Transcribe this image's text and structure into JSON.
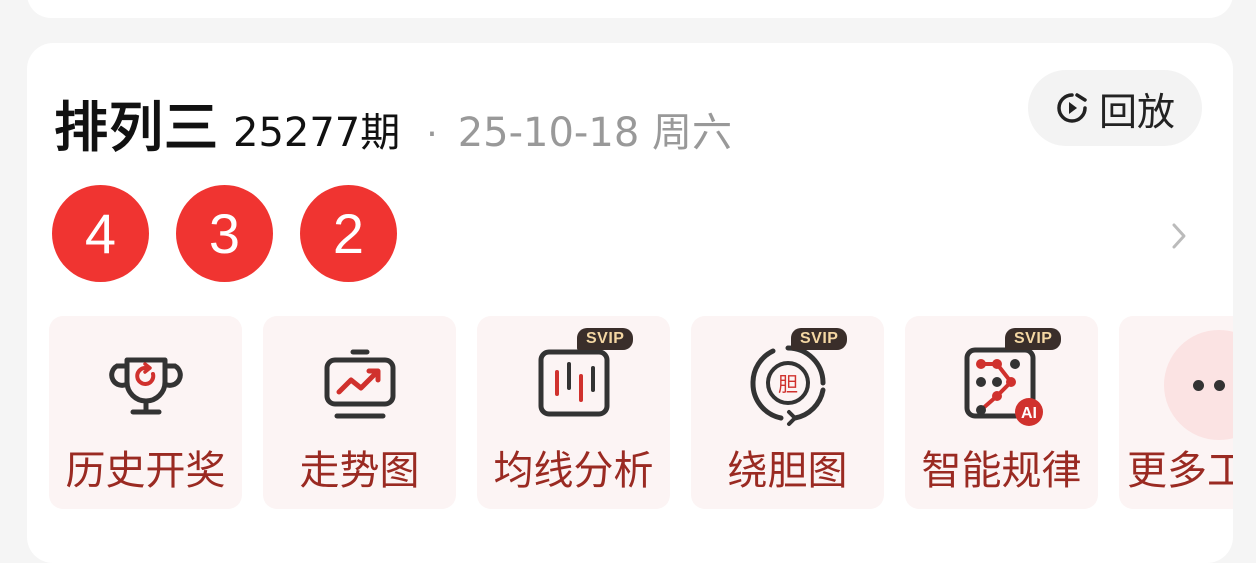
{
  "lottery": {
    "name": "排列三",
    "issue": "25277期",
    "separator": "·",
    "date": "25-10-18 周六"
  },
  "replay": {
    "label": "回放",
    "icon": "replay-clock-icon"
  },
  "balls": [
    "4",
    "3",
    "2"
  ],
  "colors": {
    "ball": "#f03431",
    "tile_bg": "#fcf4f4",
    "tile_label": "#9a2a22",
    "badge_bg": "#3a2e2a",
    "badge_text": "#f4d7a3"
  },
  "tiles": [
    {
      "label": "历史开奖",
      "icon": "trophy-icon",
      "badge": ""
    },
    {
      "label": "走势图",
      "icon": "trend-chart-icon",
      "badge": ""
    },
    {
      "label": "均线分析",
      "icon": "candlestick-icon",
      "badge": "SVIP"
    },
    {
      "label": "绕胆图",
      "icon": "cycle-icon",
      "badge": "SVIP"
    },
    {
      "label": "智能规律",
      "icon": "ai-pattern-icon",
      "badge": "SVIP"
    },
    {
      "label": "更多工具",
      "icon": "more-icon",
      "badge": ""
    }
  ],
  "icons": {
    "chevron": "chevron-right-icon",
    "ai_badge": "AI",
    "cycle_center": "胆"
  }
}
